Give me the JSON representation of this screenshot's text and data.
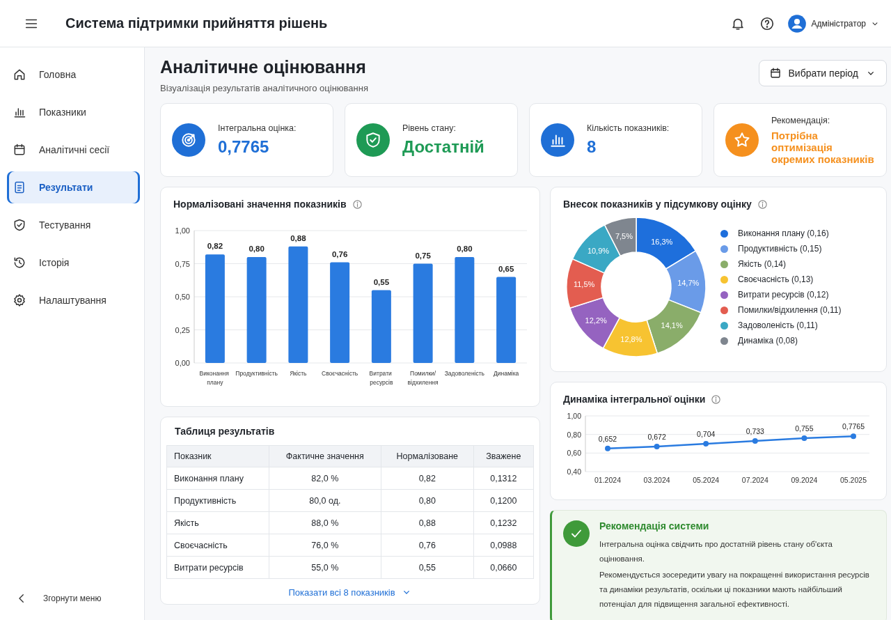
{
  "header": {
    "title": "Система підтримки прийняття рішень",
    "user": "Адміністратор"
  },
  "sidebar": {
    "items": [
      {
        "label": "Головна",
        "selected": false
      },
      {
        "label": "Показники",
        "selected": false
      },
      {
        "label": "Аналітичні сесії",
        "selected": false
      },
      {
        "label": "Результати",
        "selected": true
      },
      {
        "label": "Тестування",
        "selected": false
      },
      {
        "label": "Історія",
        "selected": false
      },
      {
        "label": "Налаштування",
        "selected": false
      }
    ],
    "collapse": "Згорнути меню"
  },
  "page": {
    "title": "Аналітичне оцінювання",
    "subtitle": "Візуалізація результатів аналітичного оцінювання",
    "period_button": "Вибрати період"
  },
  "stats": [
    {
      "label": "Інтегральна оцінка:",
      "value": "0,7765",
      "color": "#1f6fd6"
    },
    {
      "label": "Рівень стану:",
      "value": "Достатній",
      "color": "#1e9a55"
    },
    {
      "label": "Кількість показників:",
      "value": "8",
      "color": "#1f6fd6"
    },
    {
      "label": "Рекомендація:",
      "value": "Потрібна оптимізація окремих показників",
      "color": "#f5901e"
    }
  ],
  "bar_panel": {
    "title": "Нормалізовані значення показників",
    "chart_data": {
      "type": "bar",
      "categories": [
        "Виконання плану",
        "Продуктивність",
        "Якість",
        "Своєчасність",
        "Витрати ресурсів",
        "Помилки/відхилення",
        "Задоволеність",
        "Динаміка"
      ],
      "series": [
        {
          "color": "#2a7be0",
          "values": [
            0.82,
            0.8,
            0.88,
            0.76,
            0.55,
            0.75,
            0.8,
            0.65
          ]
        }
      ],
      "grid": true,
      "value_labels": [
        "0,82",
        "0,80",
        "0,88",
        "0,76",
        "0,55",
        "0,75",
        "0,80",
        "0,65"
      ],
      "ylim": [
        0,
        1
      ],
      "yticks": [
        {
          "value": 0,
          "label": "0,00"
        },
        {
          "value": 0.25,
          "label": "0,25"
        },
        {
          "value": 0.5,
          "label": "0,50"
        },
        {
          "value": 0.75,
          "label": "0,75"
        },
        {
          "value": 1,
          "label": "1,00"
        }
      ]
    }
  },
  "table_panel": {
    "title": "Таблиця результатів",
    "columns": [
      "Показник",
      "Фактичне значення",
      "Нормалізоване",
      "Зважене"
    ],
    "rows": [
      [
        "Виконання плану",
        "82,0 %",
        "0,82",
        "0,1312"
      ],
      [
        "Продуктивність",
        "80,0 од.",
        "0,80",
        "0,1200"
      ],
      [
        "Якість",
        "88,0 %",
        "0,88",
        "0,1232"
      ],
      [
        "Своєчасність",
        "76,0 %",
        "0,76",
        "0,0988"
      ],
      [
        "Витрати ресурсів",
        "55,0 %",
        "0,55",
        "0,0660"
      ]
    ],
    "show_all": "Показати всі 8 показників"
  },
  "donut_panel": {
    "title": "Внесок показників у підсумкову оцінку",
    "chart_data": {
      "type": "donut",
      "categories": [
        "Виконання плану (0,16)",
        "Продуктивність (0,15)",
        "Якість (0,14)",
        "Своєчасність (0,13)",
        "Витрати ресурсів (0,12)",
        "Помилки/відхилення (0,11)",
        "Задоволеність (0,11)",
        "Динаміка (0,08)"
      ],
      "values": [
        16.3,
        14.7,
        14.1,
        12.8,
        12.2,
        11.5,
        10.9,
        7.5
      ],
      "colors": [
        "#1e6fdc",
        "#6a9be8",
        "#8aad6a",
        "#f7c331",
        "#9563c0",
        "#e35d50",
        "#3aa8c4",
        "#7f868f"
      ],
      "value_labels": [
        "16,3%",
        "14,7%",
        "14,1%",
        "12,8%",
        "12,2%",
        "11,5%",
        "10,9%",
        "7,5%"
      ]
    }
  },
  "line_panel": {
    "title": "Динаміка інтегральної оцінки",
    "chart_data": {
      "type": "line",
      "x": [
        "01.2024",
        "03.2024",
        "05.2024",
        "07.2024",
        "09.2024",
        "05.2025"
      ],
      "series": [
        {
          "color": "#2a7be0",
          "marker": "circle",
          "values": [
            0.65,
            0.67,
            0.7,
            0.73,
            0.76,
            0.78
          ]
        }
      ],
      "grid": true,
      "value_labels": [
        "0,652",
        "0,672",
        "0,704",
        "0,733",
        "0,755",
        "0,7765"
      ],
      "ylim": [
        0.4,
        1
      ],
      "yticks": [
        {
          "value": 0.4,
          "label": "0,40"
        },
        {
          "value": 0.6,
          "label": "0,60"
        },
        {
          "value": 0.8,
          "label": "0,80"
        },
        {
          "value": 1,
          "label": "1,00"
        }
      ]
    }
  },
  "recommendation": {
    "title": "Рекомендація системи",
    "paragraphs": [
      "Інтегральна оцінка свідчить про достатній рівень стану об'єкта оцінювання.",
      "Рекомендується зосередити увагу на покращенні використання ресурсів та динаміки результатів, оскільки ці показники мають найбільший потенціал для підвищення загальної ефективності."
    ]
  }
}
